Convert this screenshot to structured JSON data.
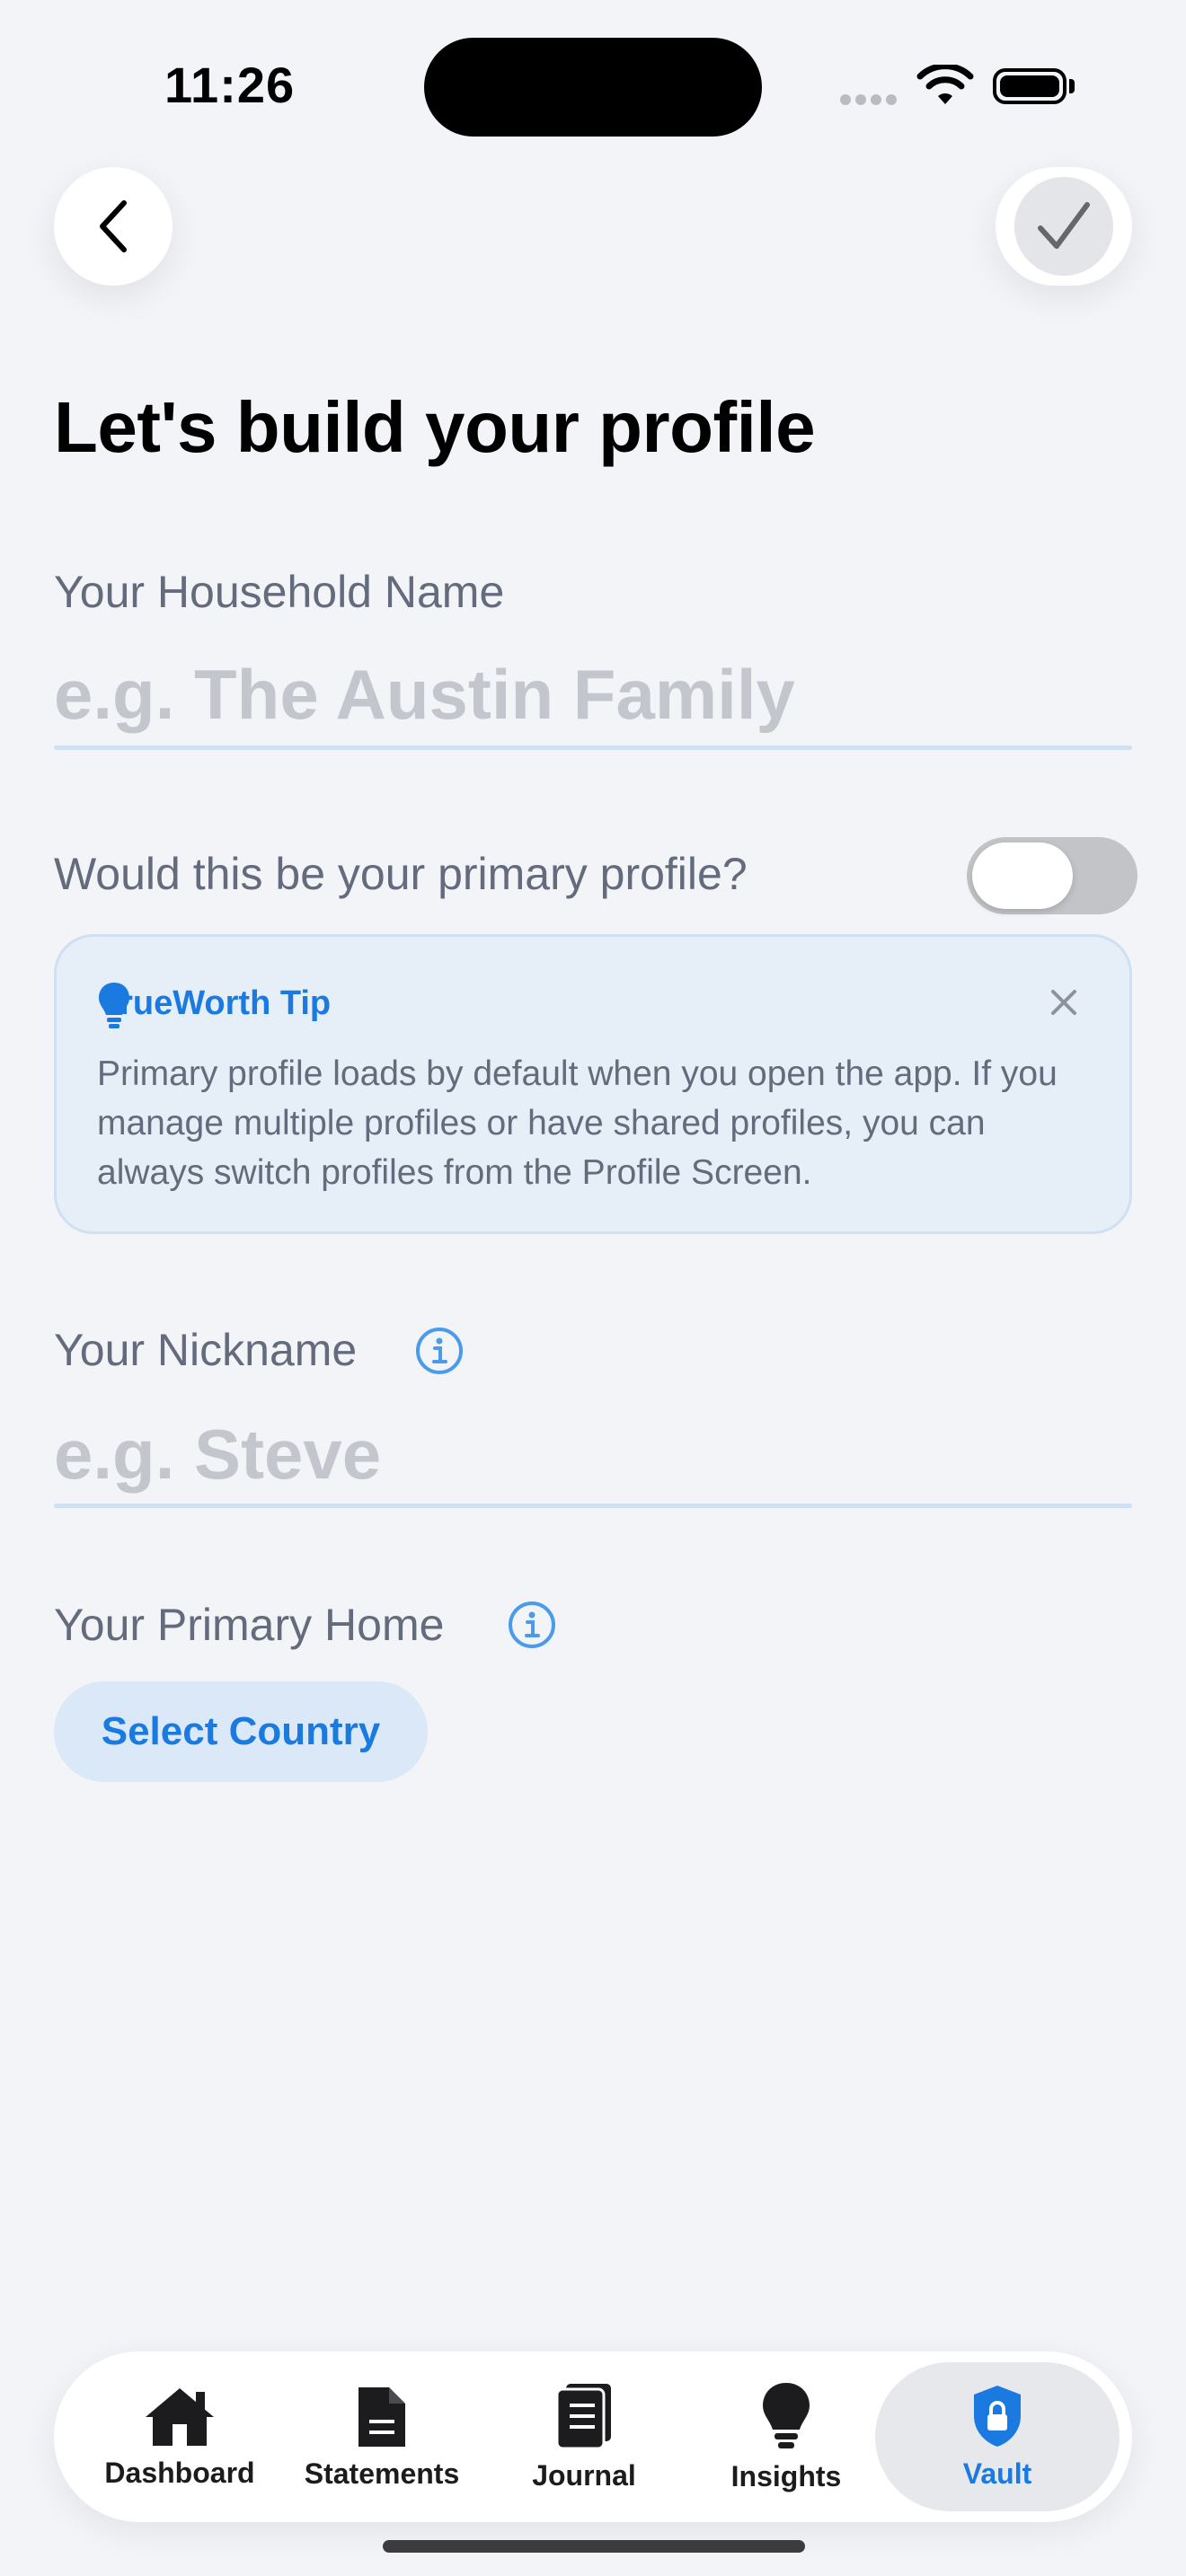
{
  "status_bar": {
    "time": "11:26"
  },
  "header": {
    "title": "Let's build your profile"
  },
  "household": {
    "label": "Your Household Name",
    "value": "",
    "placeholder": "e.g. The Austin Family"
  },
  "primary_profile": {
    "question": "Would this be your primary profile?",
    "toggle_on": false
  },
  "tip": {
    "title": "TrueWorth Tip",
    "body": "Primary profile loads by default when you open the app. If you manage multiple profiles or have shared profiles, you can always switch profiles from the Profile Screen."
  },
  "nickname": {
    "label": "Your Nickname",
    "value": "",
    "placeholder": "e.g. Steve"
  },
  "primary_home": {
    "label": "Your Primary Home",
    "button_label": "Select Country"
  },
  "tabbar": {
    "active": "Vault",
    "accent_color": "#1a7ae0",
    "items": [
      {
        "label": "Dashboard",
        "icon": "house-icon"
      },
      {
        "label": "Statements",
        "icon": "document-icon"
      },
      {
        "label": "Journal",
        "icon": "journal-icon"
      },
      {
        "label": "Insights",
        "icon": "lightbulb-icon"
      },
      {
        "label": "Vault",
        "icon": "shield-lock-icon"
      }
    ]
  }
}
